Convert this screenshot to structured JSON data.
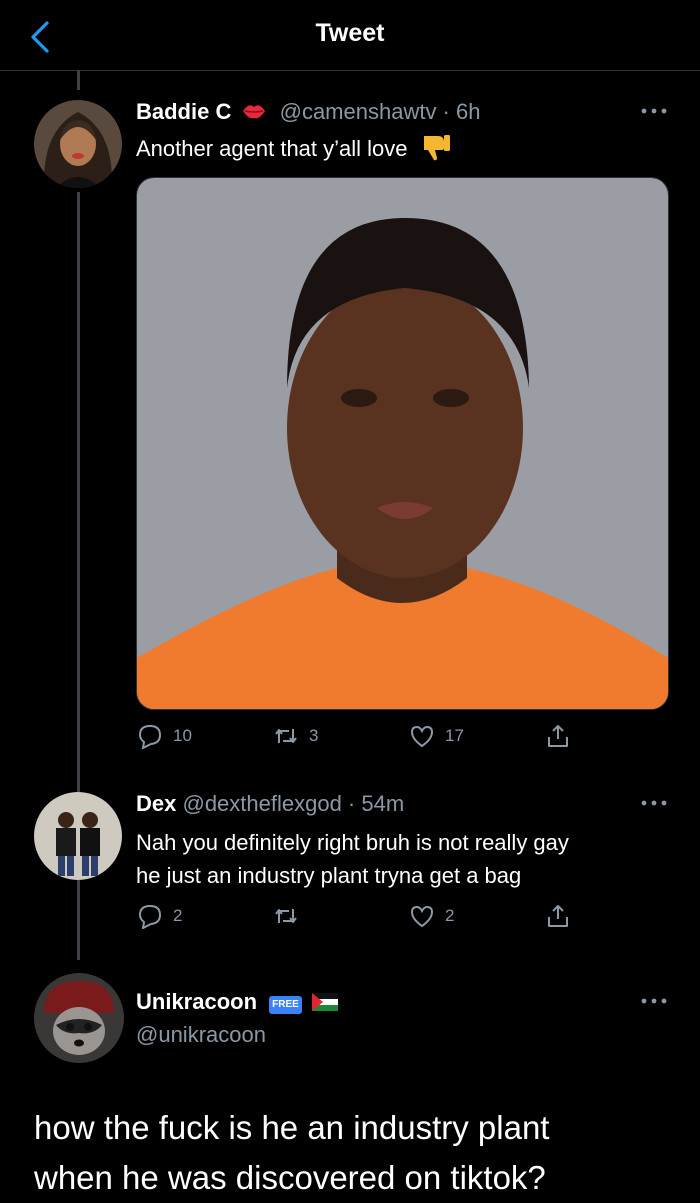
{
  "header": {
    "title": "Tweet"
  },
  "tweet": {
    "name": "Baddie C",
    "handle": "@camenshawtv · 6h",
    "text": "Another agent that y’all love",
    "reply_count": "10",
    "retweet_count": "3",
    "like_count": "17"
  },
  "reply1": {
    "name": "Dex",
    "handle": "@dextheflexgod · 54m",
    "line1": "Nah you definitely right bruh is not really gay",
    "line2": "he just an industry plant tryna get a bag",
    "reply_count": "2",
    "like_count": "2"
  },
  "reply2": {
    "name": "Unikracoon",
    "badge": "FREE",
    "handle": "@unikracoon",
    "line1": "how the fuck is he an industry plant",
    "line2": "when he was discovered on tiktok?"
  },
  "colors": {
    "accent": "#1d9bf0",
    "muted": "#8b98a5",
    "border": "#2f3336"
  },
  "icons": [
    "chevron-left-icon",
    "lips-emoji-icon",
    "thumbs-down-emoji-icon",
    "more-icon",
    "reply-icon",
    "retweet-icon",
    "like-icon",
    "share-icon",
    "free-badge-icon",
    "palestine-flag-icon"
  ]
}
